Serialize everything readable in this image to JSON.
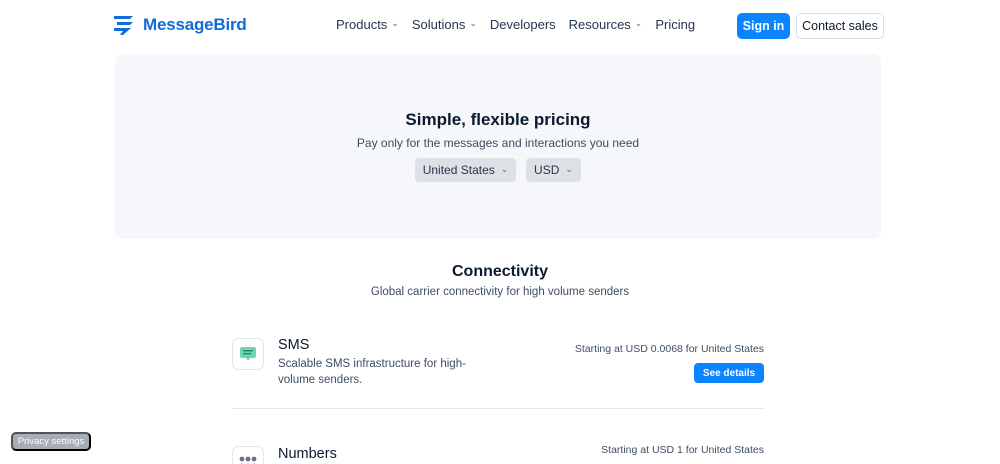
{
  "header": {
    "logo_text": "MessageBird",
    "nav": [
      {
        "label": "Products",
        "has_dropdown": true
      },
      {
        "label": "Solutions",
        "has_dropdown": true
      },
      {
        "label": "Developers",
        "has_dropdown": false
      },
      {
        "label": "Resources",
        "has_dropdown": true
      },
      {
        "label": "Pricing",
        "has_dropdown": false
      }
    ],
    "signin_label": "Sign in",
    "contact_label": "Contact sales"
  },
  "hero": {
    "title": "Simple, flexible pricing",
    "subtitle": "Pay only for the messages and interactions you need",
    "country_select": "United States",
    "currency_select": "USD"
  },
  "connectivity": {
    "title": "Connectivity",
    "subtitle": "Global carrier connectivity for high volume senders",
    "products": [
      {
        "name": "SMS",
        "description": "Scalable SMS infrastructure for high-volume senders.",
        "price": "Starting at USD 0.0068 for United States",
        "action_label": "See details",
        "icon": "sms-icon"
      },
      {
        "name": "Numbers",
        "price": "Starting at USD 1 for United States",
        "icon": "numbers-icon"
      }
    ]
  },
  "privacy_label": "Privacy settings",
  "colors": {
    "brand": "#0a84ff",
    "logo": "#0f6cdb",
    "hero_bg": "#f5f7fa",
    "text_dark": "#0b1a2e"
  }
}
